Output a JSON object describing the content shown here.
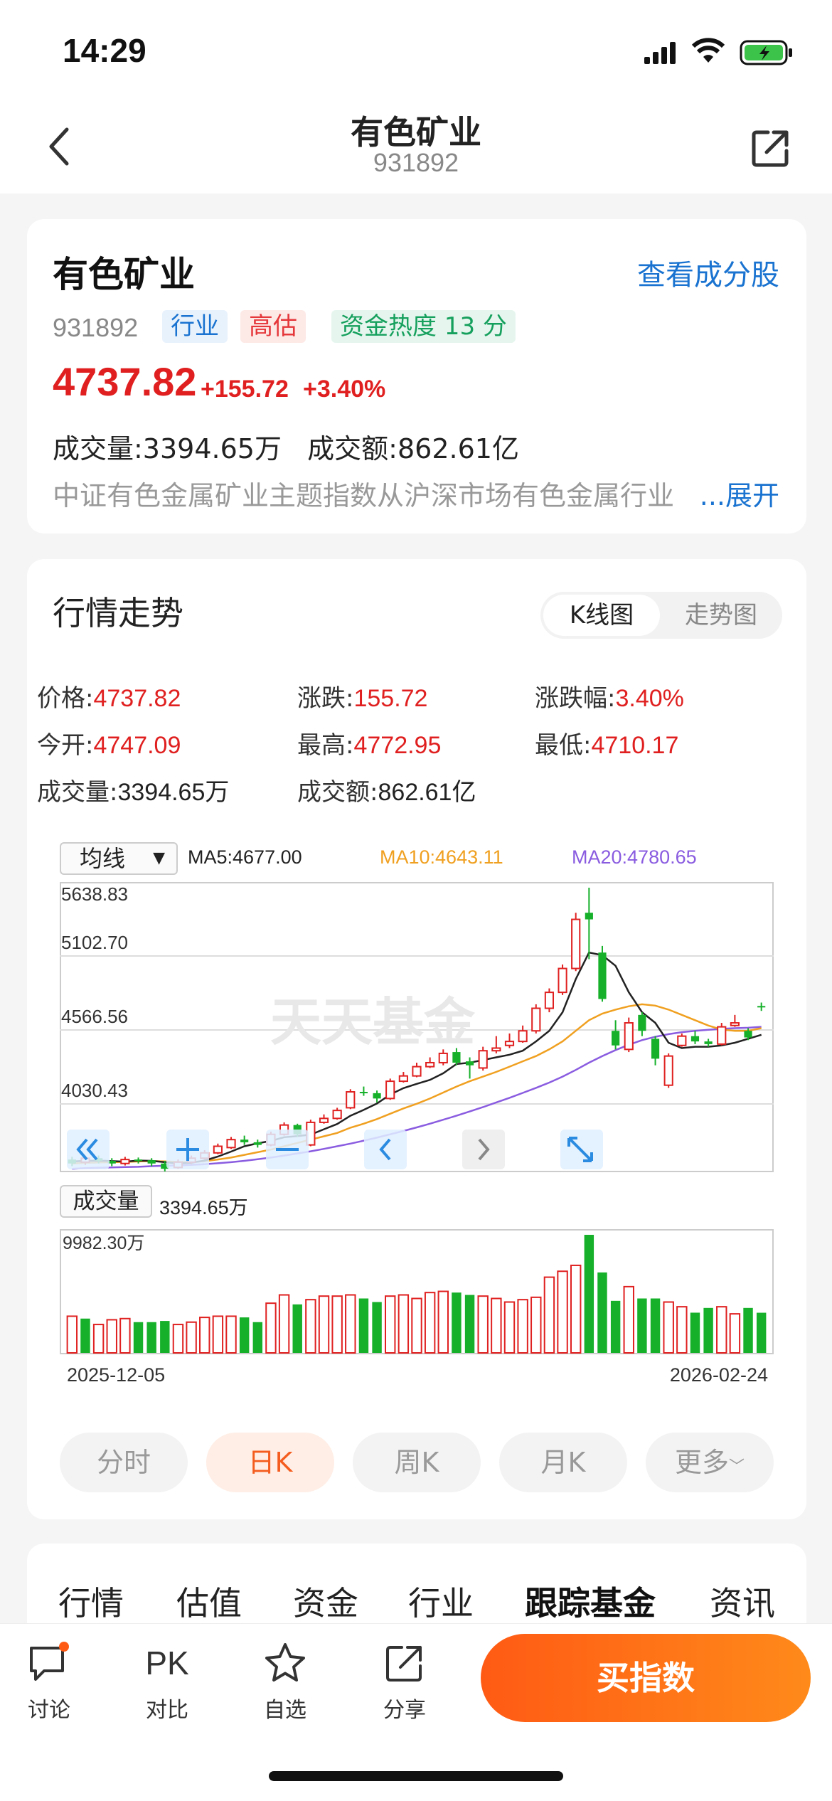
{
  "status": {
    "time": "14:29"
  },
  "nav": {
    "title": "有色矿业",
    "code": "931892"
  },
  "summary": {
    "name": "有色矿业",
    "view_constituents": "查看成分股",
    "code": "931892",
    "tags": {
      "industry": "行业",
      "valuation": "高估",
      "heat": "资金热度 13 分"
    },
    "price": "4737.82",
    "change": "+155.72",
    "change_pct": "+3.40%",
    "volume_line": "成交量:3394.65万   成交额:862.61亿",
    "description": "中证有色金属矿业主题指数从沪深市场有色金属行业",
    "expand": "...展开"
  },
  "trend": {
    "title": "行情走势",
    "seg_k": "K线图",
    "seg_trend": "走势图",
    "quote": {
      "price_label": "价格:",
      "price": "4737.82",
      "change_label": "涨跌:",
      "change": "155.72",
      "pct_label": "涨跌幅:",
      "pct": "3.40%",
      "open_label": "今开:",
      "open": "4747.09",
      "high_label": "最高:",
      "high": "4772.95",
      "low_label": "最低:",
      "low": "4710.17",
      "vol_label": "成交量:",
      "vol": "3394.65万",
      "amt_label": "成交额:",
      "amt": "862.61亿"
    },
    "ma_select": "均线",
    "ma5": "MA5:4677.00",
    "ma10": "MA10:4643.11",
    "ma20": "MA20:4780.65",
    "volume_tag": "成交量",
    "volume_value": "3394.65万",
    "date_start": "2025-12-05",
    "date_end": "2026-02-24",
    "periods": [
      "分时",
      "日K",
      "周K",
      "月K",
      "更多"
    ]
  },
  "chart_data": [
    {
      "type": "candlestick",
      "title": "",
      "y_ticks": [
        "5638.83",
        "5102.70",
        "4566.56",
        "4030.43"
      ],
      "ylim": [
        3494.3,
        5638.83
      ],
      "x_range": [
        "2025-12-05",
        "2026-02-24"
      ],
      "candles": [
        {
          "o": 3590,
          "c": 3560,
          "h": 3610,
          "l": 3540
        },
        {
          "o": 3570,
          "c": 3600,
          "h": 3620,
          "l": 3550
        },
        {
          "o": 3600,
          "c": 3580,
          "h": 3620,
          "l": 3560
        },
        {
          "o": 3580,
          "c": 3560,
          "h": 3600,
          "l": 3540
        },
        {
          "o": 3560,
          "c": 3590,
          "h": 3610,
          "l": 3545
        },
        {
          "o": 3590,
          "c": 3580,
          "h": 3605,
          "l": 3560
        },
        {
          "o": 3585,
          "c": 3560,
          "h": 3600,
          "l": 3540
        },
        {
          "o": 3560,
          "c": 3520,
          "h": 3580,
          "l": 3500
        },
        {
          "o": 3530,
          "c": 3570,
          "h": 3590,
          "l": 3520
        },
        {
          "o": 3570,
          "c": 3600,
          "h": 3620,
          "l": 3555
        },
        {
          "o": 3600,
          "c": 3640,
          "h": 3660,
          "l": 3590
        },
        {
          "o": 3640,
          "c": 3690,
          "h": 3710,
          "l": 3630
        },
        {
          "o": 3680,
          "c": 3740,
          "h": 3760,
          "l": 3670
        },
        {
          "o": 3740,
          "c": 3720,
          "h": 3770,
          "l": 3700
        },
        {
          "o": 3720,
          "c": 3700,
          "h": 3740,
          "l": 3680
        },
        {
          "o": 3700,
          "c": 3780,
          "h": 3800,
          "l": 3690
        },
        {
          "o": 3780,
          "c": 3850,
          "h": 3870,
          "l": 3770
        },
        {
          "o": 3850,
          "c": 3780,
          "h": 3860,
          "l": 3760
        },
        {
          "o": 3700,
          "c": 3870,
          "h": 3890,
          "l": 3690
        },
        {
          "o": 3870,
          "c": 3900,
          "h": 3930,
          "l": 3860
        },
        {
          "o": 3900,
          "c": 3960,
          "h": 3980,
          "l": 3890
        },
        {
          "o": 3980,
          "c": 4100,
          "h": 4120,
          "l": 3970
        },
        {
          "o": 4100,
          "c": 4090,
          "h": 4140,
          "l": 4070
        },
        {
          "o": 4090,
          "c": 4050,
          "h": 4110,
          "l": 4020
        },
        {
          "o": 4050,
          "c": 4180,
          "h": 4200,
          "l": 4040
        },
        {
          "o": 4180,
          "c": 4220,
          "h": 4250,
          "l": 4170
        },
        {
          "o": 4220,
          "c": 4290,
          "h": 4320,
          "l": 4210
        },
        {
          "o": 4290,
          "c": 4320,
          "h": 4360,
          "l": 4280
        },
        {
          "o": 4320,
          "c": 4390,
          "h": 4420,
          "l": 4300
        },
        {
          "o": 4400,
          "c": 4320,
          "h": 4430,
          "l": 4300
        },
        {
          "o": 4330,
          "c": 4300,
          "h": 4360,
          "l": 4200
        },
        {
          "o": 4280,
          "c": 4410,
          "h": 4440,
          "l": 4260
        },
        {
          "o": 4410,
          "c": 4430,
          "h": 4520,
          "l": 4390
        },
        {
          "o": 4450,
          "c": 4480,
          "h": 4540,
          "l": 4430
        },
        {
          "o": 4480,
          "c": 4560,
          "h": 4600,
          "l": 4470
        },
        {
          "o": 4560,
          "c": 4730,
          "h": 4760,
          "l": 4540
        },
        {
          "o": 4730,
          "c": 4850,
          "h": 4880,
          "l": 4700
        },
        {
          "o": 4850,
          "c": 5030,
          "h": 5060,
          "l": 4830
        },
        {
          "o": 5030,
          "c": 5400,
          "h": 5450,
          "l": 5010
        },
        {
          "o": 5450,
          "c": 5400,
          "h": 5638.83,
          "l": 5100
        },
        {
          "o": 5150,
          "c": 4800,
          "h": 5200,
          "l": 4780
        },
        {
          "o": 4560,
          "c": 4450,
          "h": 4640,
          "l": 4420
        },
        {
          "o": 4420,
          "c": 4620,
          "h": 4660,
          "l": 4400
        },
        {
          "o": 4680,
          "c": 4560,
          "h": 4700,
          "l": 4520
        },
        {
          "o": 4500,
          "c": 4350,
          "h": 4520,
          "l": 4300
        },
        {
          "o": 4150,
          "c": 4370,
          "h": 4390,
          "l": 4130
        },
        {
          "o": 4450,
          "c": 4520,
          "h": 4540,
          "l": 4440
        },
        {
          "o": 4520,
          "c": 4480,
          "h": 4560,
          "l": 4460
        },
        {
          "o": 4480,
          "c": 4460,
          "h": 4500,
          "l": 4440
        },
        {
          "o": 4460,
          "c": 4590,
          "h": 4620,
          "l": 4450
        },
        {
          "o": 4600,
          "c": 4620,
          "h": 4680,
          "l": 4590
        },
        {
          "o": 4560,
          "c": 4510,
          "h": 4580,
          "l": 4490
        },
        {
          "o": 4747.09,
          "c": 4737.82,
          "h": 4772.95,
          "l": 4710.17
        }
      ],
      "ma5": [
        3575,
        3580,
        3582,
        3578,
        3574,
        3582,
        3580,
        3570,
        3560,
        3566,
        3582,
        3612,
        3650,
        3690,
        3712,
        3730,
        3758,
        3766,
        3778,
        3818,
        3858,
        3920,
        3964,
        4012,
        4080,
        4128,
        4160,
        4190,
        4240,
        4310,
        4320,
        4340,
        4360,
        4380,
        4410,
        4480,
        4560,
        4700,
        4950,
        5150,
        5130,
        5050,
        4850,
        4700,
        4620,
        4470,
        4430,
        4440,
        4440,
        4450,
        4470,
        4500,
        4530
      ],
      "ma10": [
        3560,
        3565,
        3568,
        3570,
        3572,
        3575,
        3578,
        3576,
        3572,
        3570,
        3578,
        3590,
        3605,
        3625,
        3645,
        3665,
        3690,
        3715,
        3740,
        3765,
        3790,
        3830,
        3860,
        3895,
        3935,
        3975,
        4010,
        4050,
        4095,
        4140,
        4180,
        4215,
        4250,
        4290,
        4330,
        4370,
        4420,
        4480,
        4560,
        4640,
        4690,
        4720,
        4745,
        4760,
        4750,
        4720,
        4680,
        4640,
        4600,
        4570,
        4560,
        4560,
        4580
      ],
      "ma20": [
        3520,
        3525,
        3528,
        3530,
        3533,
        3535,
        3540,
        3543,
        3546,
        3550,
        3555,
        3562,
        3570,
        3580,
        3592,
        3605,
        3620,
        3636,
        3652,
        3670,
        3690,
        3710,
        3732,
        3755,
        3780,
        3805,
        3832,
        3860,
        3890,
        3920,
        3952,
        3985,
        4020,
        4055,
        4092,
        4130,
        4170,
        4215,
        4265,
        4320,
        4370,
        4415,
        4455,
        4490,
        4515,
        4535,
        4550,
        4560,
        4568,
        4575,
        4580,
        4583,
        4590
      ]
    },
    {
      "type": "bar",
      "title": "",
      "y_ticks": [
        "9982.30万"
      ],
      "ylim": [
        0,
        9982.3
      ],
      "values": [
        3100,
        2900,
        2400,
        2800,
        2900,
        2600,
        2600,
        2700,
        2400,
        2600,
        3000,
        3100,
        3100,
        3000,
        2600,
        4200,
        4900,
        4100,
        4500,
        4800,
        4800,
        4900,
        4600,
        4300,
        4800,
        4900,
        4600,
        5100,
        5200,
        5100,
        4900,
        4800,
        4600,
        4300,
        4500,
        4700,
        6400,
        6900,
        7400,
        9982.3,
        6800,
        4400,
        5600,
        4600,
        4600,
        4300,
        3900,
        3400,
        3800,
        3900,
        3300,
        3800,
        3394.65
      ],
      "rising": [
        1,
        0,
        1,
        1,
        1,
        0,
        0,
        0,
        1,
        1,
        1,
        1,
        1,
        0,
        0,
        1,
        1,
        0,
        1,
        1,
        1,
        1,
        0,
        0,
        1,
        1,
        1,
        1,
        1,
        0,
        0,
        1,
        1,
        1,
        1,
        1,
        1,
        1,
        1,
        0,
        0,
        0,
        1,
        0,
        0,
        1,
        1,
        0,
        0,
        1,
        1,
        0,
        0
      ]
    }
  ],
  "tabs": [
    "行情",
    "估值",
    "资金",
    "行业",
    "跟踪基金",
    "资讯"
  ],
  "bottom": {
    "discuss": "讨论",
    "compare": "对比",
    "compare_icon_text": "PK",
    "watch": "自选",
    "share": "分享",
    "buy": "买指数"
  },
  "colors": {
    "up": "#e02020",
    "down": "#16b02a",
    "ma5": "#222222",
    "ma10": "#f0a020",
    "ma20": "#8a5ce0",
    "accent": "#ff6a18",
    "link": "#1a73d0"
  }
}
